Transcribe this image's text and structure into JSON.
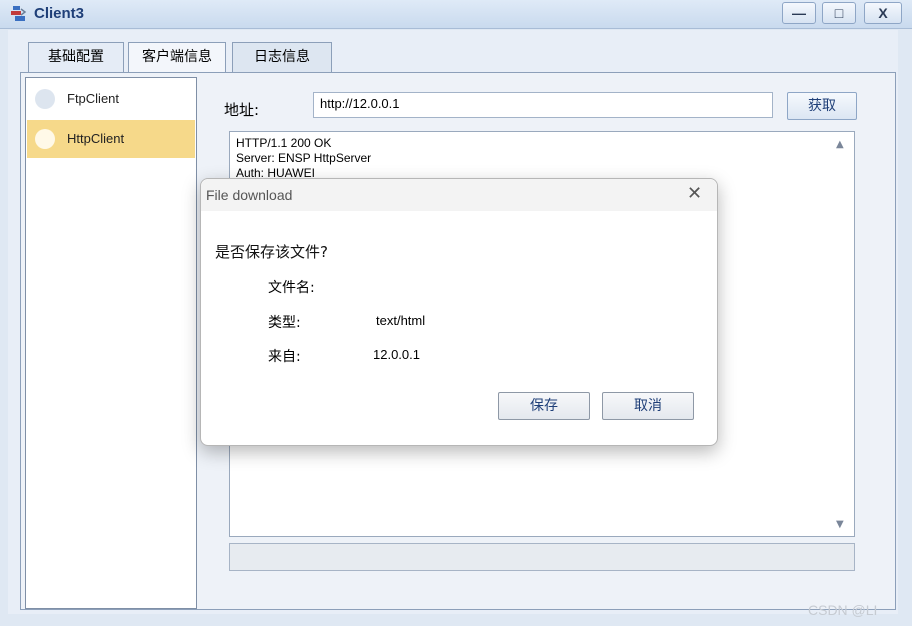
{
  "window": {
    "title": "Client3",
    "min_glyph": "—",
    "max_glyph": "□",
    "close_glyph": "X"
  },
  "tabs": [
    {
      "label": "基础配置"
    },
    {
      "label": "客户端信息"
    },
    {
      "label": "日志信息"
    }
  ],
  "sidebar": {
    "items": [
      {
        "label": "FtpClient"
      },
      {
        "label": "HttpClient"
      }
    ]
  },
  "address": {
    "label": "地址:",
    "value": "http://12.0.0.1",
    "button": "获取"
  },
  "response": {
    "text": "HTTP/1.1 200 OK\nServer: ENSP HttpServer\nAuth: HUAWEI"
  },
  "dialog": {
    "title": "File download",
    "question": "是否保存该文件?",
    "filename_label": "文件名:",
    "type_label": "类型:",
    "type_value": "text/html",
    "from_label": "来自:",
    "from_value": "12.0.0.1",
    "save_button": "保存",
    "cancel_button": "取消"
  },
  "watermark": "CSDN @LI"
}
